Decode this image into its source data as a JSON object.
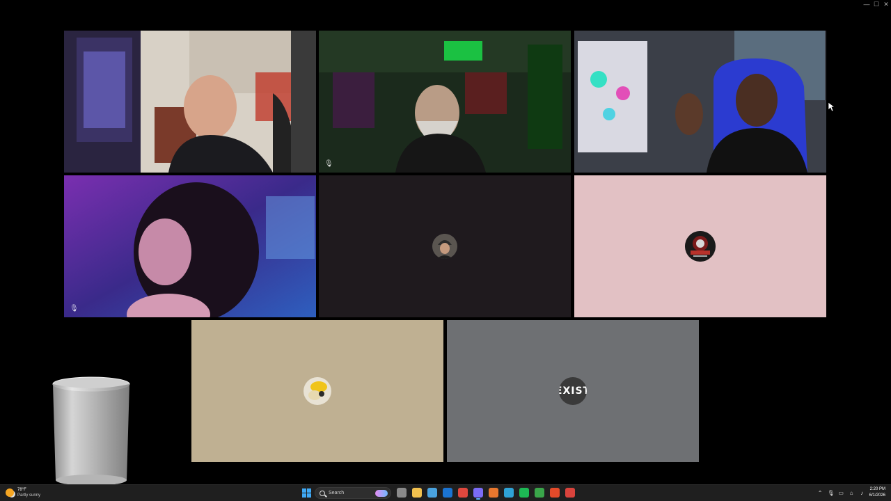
{
  "window": {
    "minimize_glyph": "—",
    "maximize_glyph": "☐",
    "close_glyph": "✕"
  },
  "participants": [
    {
      "kind": "video",
      "scene": "streamer-room-iron-goddess",
      "mic_muted": false,
      "speaking": false
    },
    {
      "kind": "video",
      "scene": "green-lit-room-kick-sign",
      "mic_muted": true,
      "speaking": false
    },
    {
      "kind": "video",
      "scene": "gaming-pc-setup-blue-chair",
      "mic_muted": false,
      "speaking": true
    },
    {
      "kind": "video",
      "scene": "purple-lit-portrait",
      "mic_muted": true,
      "speaking": false
    },
    {
      "kind": "avatar",
      "avatar_icon": "helmet-portrait-avatar",
      "tile_color": "#1f1a1e",
      "avatar_text": ""
    },
    {
      "kind": "avatar",
      "avatar_icon": "grey-blood-logo-avatar",
      "tile_color": "#e2c1c4",
      "avatar_text": ""
    },
    {
      "kind": "avatar",
      "avatar_icon": "cartoon-character-avatar",
      "tile_color": "#bfb092",
      "avatar_text": ""
    },
    {
      "kind": "avatar",
      "avatar_icon": "exist-logo-avatar",
      "tile_color": "#6e7073",
      "avatar_text": "EXIST"
    }
  ],
  "overlay": {
    "glass_icon": "drinking-glass-overlay"
  },
  "taskbar": {
    "weather": {
      "temp": "78°F",
      "desc": "Partly sunny",
      "icon": "partly-sunny-icon"
    },
    "search_label": "Search",
    "apps": [
      {
        "icon": "task-view-icon",
        "color": "#8a8a8a",
        "active": false
      },
      {
        "icon": "file-explorer-icon",
        "color": "#f2c14e",
        "active": false
      },
      {
        "icon": "calendar-app-icon",
        "color": "#4aa3df",
        "active": false
      },
      {
        "icon": "outlook-icon",
        "color": "#1b74d1",
        "active": false
      },
      {
        "icon": "chrome-icon",
        "color": "#e0483e",
        "active": false
      },
      {
        "icon": "discord-icon",
        "color": "#7b6cf6",
        "active": true
      },
      {
        "icon": "office-app-icon",
        "color": "#e8772e",
        "active": false
      },
      {
        "icon": "edge-icon",
        "color": "#2fa3d6",
        "active": false
      },
      {
        "icon": "spotify-icon",
        "color": "#1db954",
        "active": false
      },
      {
        "icon": "xbox-icon",
        "color": "#3aa54a",
        "active": false
      },
      {
        "icon": "brave-icon",
        "color": "#e44b2a",
        "active": false
      },
      {
        "icon": "media-app-icon",
        "color": "#d9433c",
        "active": false
      }
    ],
    "clock": {
      "time": "2:20 PM",
      "date": "6/1/2026"
    }
  }
}
